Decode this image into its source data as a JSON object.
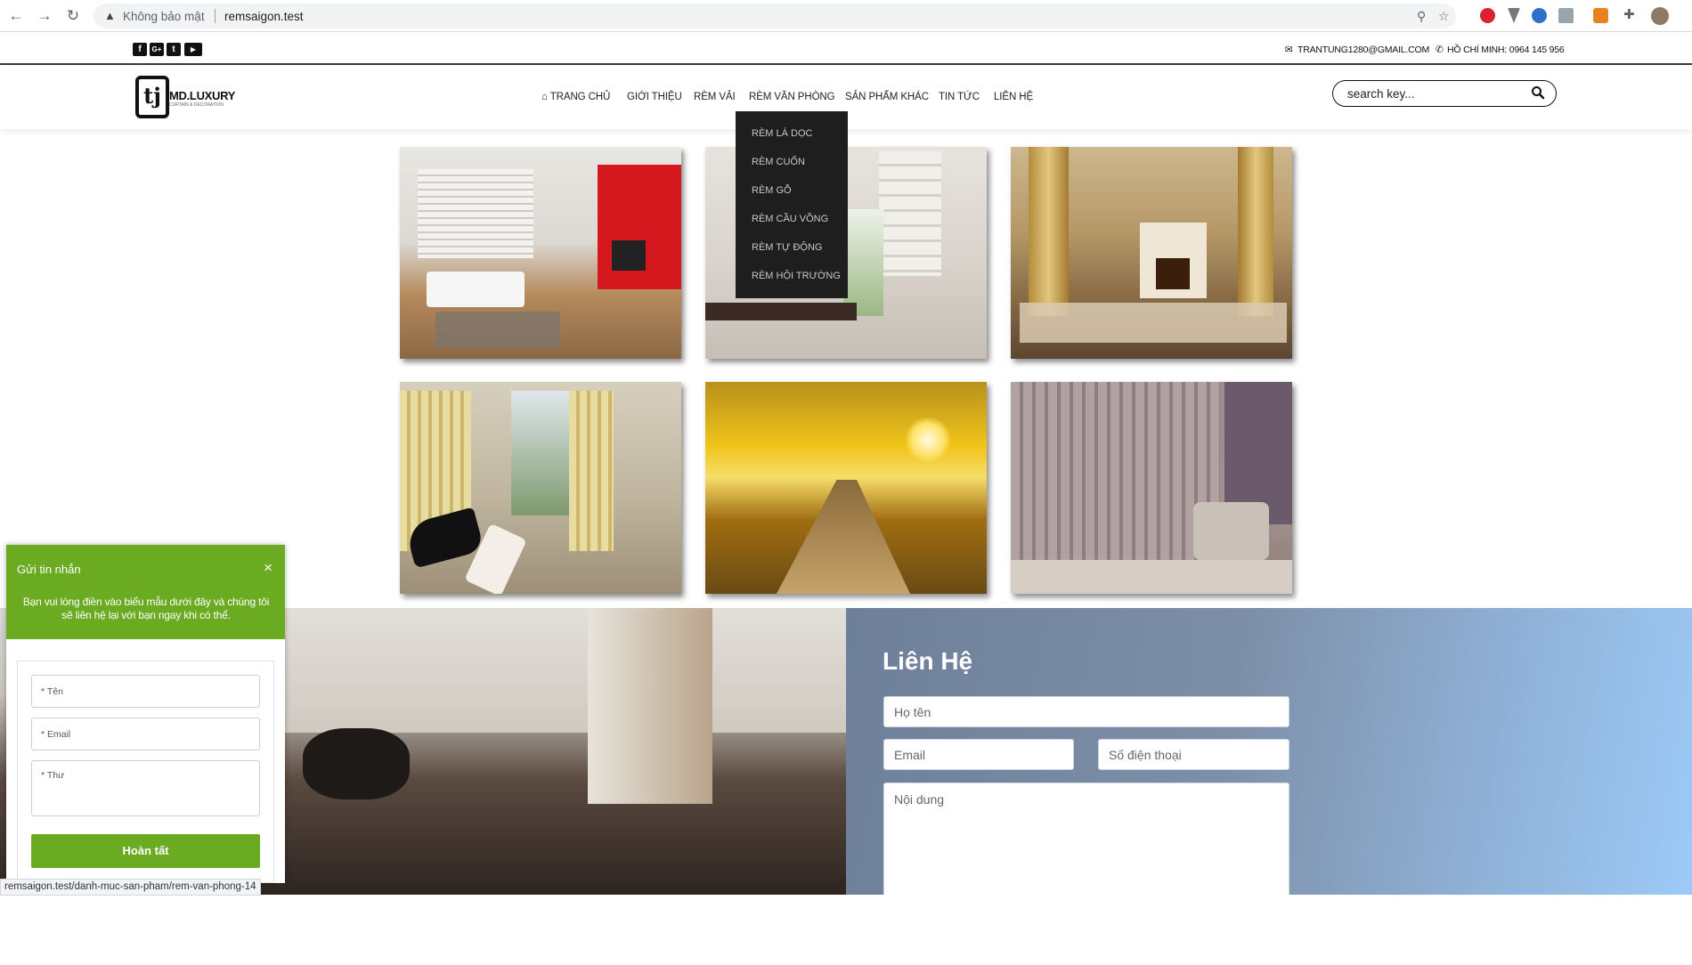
{
  "browser": {
    "not_secure_label": "Không bảo mật",
    "url": "remsaigon.test",
    "status_url": "remsaigon.test/danh-muc-san-pham/rem-van-phong-14"
  },
  "topbar": {
    "social": [
      "facebook-icon",
      "google-plus-icon",
      "twitter-icon",
      "youtube-icon"
    ],
    "email": "TRANTUNG1280@GMAIL.COM",
    "phone": "HỒ CHÍ MINH: 0964 145 956"
  },
  "header": {
    "logo_mark": "tj",
    "logo_text": "MD.LUXURY",
    "logo_sub": "CURTAIN & DECORATION",
    "menu": {
      "home": "TRANG CHỦ",
      "about": "GIỚI THIỆU",
      "fabric": "RÈM VẢI",
      "office": "RÈM VĂN PHÒNG",
      "other": "SẢN PHẨM KHÁC",
      "news": "TIN TỨC",
      "contact": "LIÊN HỆ"
    },
    "search_placeholder": "search key..."
  },
  "dropdown": {
    "items": [
      "RÈM LÁ DỌC",
      "RÈM CUỐN",
      "RÈM GỖ",
      "RÈM CẦU VỒNG",
      "RÈM TỰ ĐỘNG",
      "RÈM HỘI TRƯỜNG"
    ]
  },
  "contact": {
    "title": "Liên Hệ",
    "name_placeholder": "Họ tên",
    "email_placeholder": "Email",
    "phone_placeholder": "Số điện thoại",
    "message_placeholder": "Nội dung"
  },
  "chat": {
    "title": "Gửi tin nhắn",
    "close": "×",
    "description": "Bạn vui lòng điền vào biểu mẫu dưới đây và chúng tôi sẽ liên hệ lại với bạn ngay khi có thể.",
    "name_placeholder": "* Tên",
    "email_placeholder": "* Email",
    "message_placeholder": "* Thư",
    "submit": "Hoàn tất"
  },
  "colors": {
    "accent_green": "#6aab22",
    "dropdown_bg": "#1e1e1e",
    "contact_gradient_start": "#6e7f99",
    "contact_gradient_end": "#9ccaf7"
  }
}
